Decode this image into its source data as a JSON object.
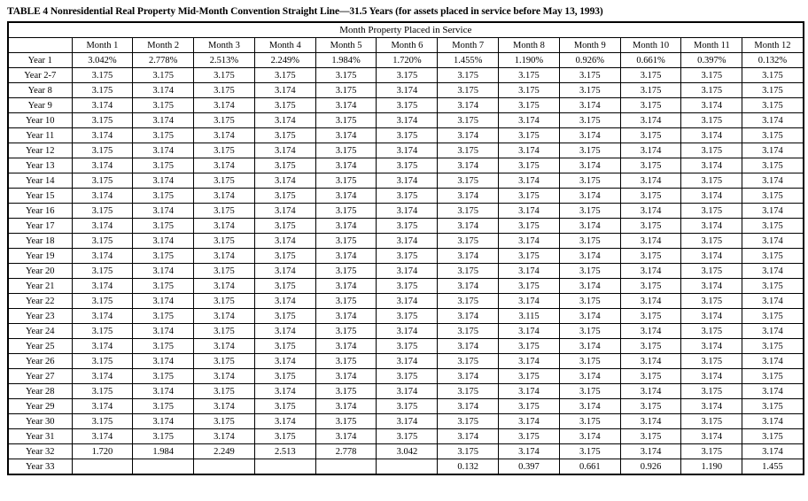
{
  "caption": "TABLE 4 Nonresidential Real Property Mid-Month Convention Straight Line—31.5 Years (for assets placed in service before May 13, 1993)",
  "table": {
    "spanner_header": "Month Property Placed in Service",
    "corner_header": "",
    "column_headers": [
      "Month 1",
      "Month 2",
      "Month 3",
      "Month 4",
      "Month 5",
      "Month 6",
      "Month 7",
      "Month 8",
      "Month 9",
      "Month 10",
      "Month 11",
      "Month 12"
    ],
    "rows": [
      {
        "year": "Year 1",
        "values": [
          "3.042%",
          "2.778%",
          "2.513%",
          "2.249%",
          "1.984%",
          "1.720%",
          "1.455%",
          "1.190%",
          "0.926%",
          "0.661%",
          "0.397%",
          "0.132%"
        ]
      },
      {
        "year": "Year 2-7",
        "values": [
          "3.175",
          "3.175",
          "3.175",
          "3.175",
          "3.175",
          "3.175",
          "3.175",
          "3.175",
          "3.175",
          "3.175",
          "3.175",
          "3.175"
        ]
      },
      {
        "year": "Year 8",
        "values": [
          "3.175",
          "3.174",
          "3.175",
          "3.174",
          "3.175",
          "3.174",
          "3.175",
          "3.175",
          "3.175",
          "3.175",
          "3.175",
          "3.175"
        ]
      },
      {
        "year": "Year 9",
        "values": [
          "3.174",
          "3.175",
          "3.174",
          "3.175",
          "3.174",
          "3.175",
          "3.174",
          "3.175",
          "3.174",
          "3.175",
          "3.174",
          "3.175"
        ]
      },
      {
        "year": "Year 10",
        "values": [
          "3.175",
          "3.174",
          "3.175",
          "3.174",
          "3.175",
          "3.174",
          "3.175",
          "3.174",
          "3.175",
          "3.174",
          "3.175",
          "3.174"
        ]
      },
      {
        "year": "Year 11",
        "values": [
          "3.174",
          "3.175",
          "3.174",
          "3.175",
          "3.174",
          "3.175",
          "3.174",
          "3.175",
          "3.174",
          "3.175",
          "3.174",
          "3.175"
        ]
      },
      {
        "year": "Year 12",
        "values": [
          "3.175",
          "3.174",
          "3.175",
          "3.174",
          "3.175",
          "3.174",
          "3.175",
          "3.174",
          "3.175",
          "3.174",
          "3.175",
          "3.174"
        ]
      },
      {
        "year": "Year 13",
        "values": [
          "3.174",
          "3.175",
          "3.174",
          "3.175",
          "3.174",
          "3.175",
          "3.174",
          "3.175",
          "3.174",
          "3.175",
          "3.174",
          "3.175"
        ]
      },
      {
        "year": "Year 14",
        "values": [
          "3.175",
          "3.174",
          "3.175",
          "3.174",
          "3.175",
          "3.174",
          "3.175",
          "3.174",
          "3.175",
          "3.174",
          "3.175",
          "3.174"
        ]
      },
      {
        "year": "Year 15",
        "values": [
          "3.174",
          "3.175",
          "3.174",
          "3.175",
          "3.174",
          "3.175",
          "3.174",
          "3.175",
          "3.174",
          "3.175",
          "3.174",
          "3.175"
        ]
      },
      {
        "year": "Year 16",
        "values": [
          "3.175",
          "3.174",
          "3.175",
          "3.174",
          "3.175",
          "3.174",
          "3.175",
          "3.174",
          "3.175",
          "3.174",
          "3.175",
          "3.174"
        ]
      },
      {
        "year": "Year 17",
        "values": [
          "3.174",
          "3.175",
          "3.174",
          "3.175",
          "3.174",
          "3.175",
          "3.174",
          "3.175",
          "3.174",
          "3.175",
          "3.174",
          "3.175"
        ]
      },
      {
        "year": "Year 18",
        "values": [
          "3.175",
          "3.174",
          "3.175",
          "3.174",
          "3.175",
          "3.174",
          "3.175",
          "3.174",
          "3.175",
          "3.174",
          "3.175",
          "3.174"
        ]
      },
      {
        "year": "Year 19",
        "values": [
          "3.174",
          "3.175",
          "3.174",
          "3.175",
          "3.174",
          "3.175",
          "3.174",
          "3.175",
          "3.174",
          "3.175",
          "3.174",
          "3.175"
        ]
      },
      {
        "year": "Year 20",
        "values": [
          "3.175",
          "3.174",
          "3.175",
          "3.174",
          "3.175",
          "3.174",
          "3.175",
          "3.174",
          "3.175",
          "3.174",
          "3.175",
          "3.174"
        ]
      },
      {
        "year": "Year 21",
        "values": [
          "3.174",
          "3.175",
          "3.174",
          "3.175",
          "3.174",
          "3.175",
          "3.174",
          "3.175",
          "3.174",
          "3.175",
          "3.174",
          "3.175"
        ]
      },
      {
        "year": "Year 22",
        "values": [
          "3.175",
          "3.174",
          "3.175",
          "3.174",
          "3.175",
          "3.174",
          "3.175",
          "3.174",
          "3.175",
          "3.174",
          "3.175",
          "3.174"
        ]
      },
      {
        "year": "Year 23",
        "values": [
          "3.174",
          "3.175",
          "3.174",
          "3.175",
          "3.174",
          "3.175",
          "3.174",
          "3.115",
          "3.174",
          "3.175",
          "3.174",
          "3.175"
        ]
      },
      {
        "year": "Year 24",
        "values": [
          "3.175",
          "3.174",
          "3.175",
          "3.174",
          "3.175",
          "3.174",
          "3.175",
          "3.174",
          "3.175",
          "3.174",
          "3.175",
          "3.174"
        ]
      },
      {
        "year": "Year 25",
        "values": [
          "3.174",
          "3.175",
          "3.174",
          "3.175",
          "3.174",
          "3.175",
          "3.174",
          "3.175",
          "3.174",
          "3.175",
          "3.174",
          "3.175"
        ]
      },
      {
        "year": "Year 26",
        "values": [
          "3.175",
          "3.174",
          "3.175",
          "3.174",
          "3.175",
          "3.174",
          "3.175",
          "3.174",
          "3.175",
          "3.174",
          "3.175",
          "3.174"
        ]
      },
      {
        "year": "Year 27",
        "values": [
          "3.174",
          "3.175",
          "3.174",
          "3.175",
          "3.174",
          "3.175",
          "3.174",
          "3.175",
          "3.174",
          "3.175",
          "3.174",
          "3.175"
        ]
      },
      {
        "year": "Year 28",
        "values": [
          "3.175",
          "3.174",
          "3.175",
          "3.174",
          "3.175",
          "3.174",
          "3.175",
          "3.174",
          "3.175",
          "3.174",
          "3.175",
          "3.174"
        ]
      },
      {
        "year": "Year 29",
        "values": [
          "3.174",
          "3.175",
          "3.174",
          "3.175",
          "3.174",
          "3.175",
          "3.174",
          "3.175",
          "3.174",
          "3.175",
          "3.174",
          "3.175"
        ]
      },
      {
        "year": "Year 30",
        "values": [
          "3.175",
          "3.174",
          "3.175",
          "3.174",
          "3.175",
          "3.174",
          "3.175",
          "3.174",
          "3.175",
          "3.174",
          "3.175",
          "3.174"
        ]
      },
      {
        "year": "Year 31",
        "values": [
          "3.174",
          "3.175",
          "3.174",
          "3.175",
          "3.174",
          "3.175",
          "3.174",
          "3.175",
          "3.174",
          "3.175",
          "3.174",
          "3.175"
        ]
      },
      {
        "year": "Year 32",
        "values": [
          "1.720",
          "1.984",
          "2.249",
          "2.513",
          "2.778",
          "3.042",
          "3.175",
          "3.174",
          "3.175",
          "3.174",
          "3.175",
          "3.174"
        ]
      },
      {
        "year": "Year 33",
        "values": [
          "",
          "",
          "",
          "",
          "",
          "",
          "0.132",
          "0.397",
          "0.661",
          "0.926",
          "1.190",
          "1.455"
        ]
      }
    ]
  }
}
